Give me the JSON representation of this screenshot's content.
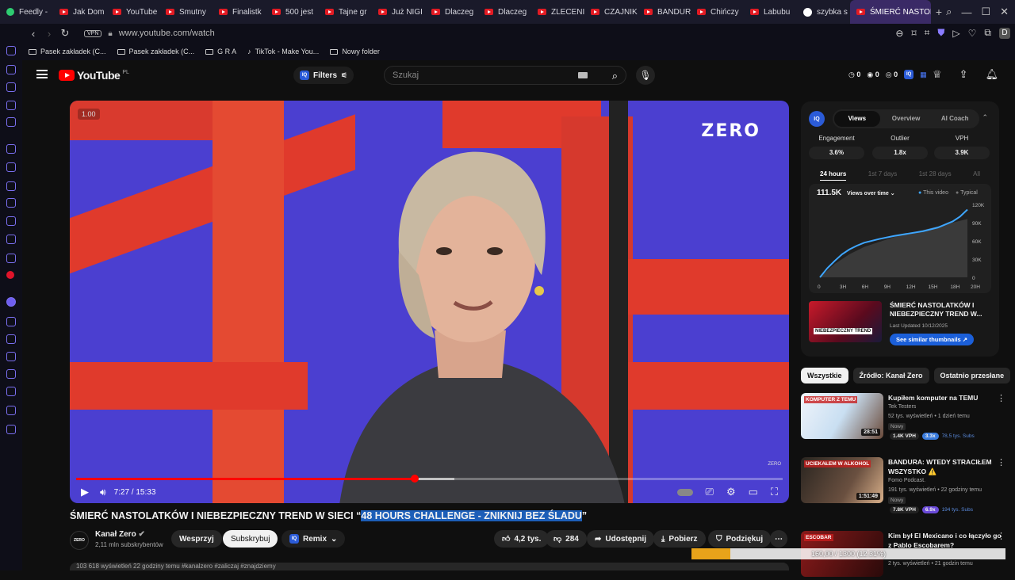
{
  "browser": {
    "tabs": [
      {
        "label": "Feedly -",
        "icon": "feedly-icon"
      },
      {
        "label": "Jak Dom",
        "icon": "youtube-icon"
      },
      {
        "label": "YouTube",
        "icon": "youtube-icon"
      },
      {
        "label": "Smutny",
        "icon": "youtube-icon"
      },
      {
        "label": "Finalistk",
        "icon": "youtube-icon"
      },
      {
        "label": "500 jest",
        "icon": "youtube-icon"
      },
      {
        "label": "Tajne gr",
        "icon": "youtube-icon"
      },
      {
        "label": "Już NIGI",
        "icon": "youtube-icon"
      },
      {
        "label": "Dlaczeg",
        "icon": "youtube-icon"
      },
      {
        "label": "Dlaczeg",
        "icon": "youtube-icon"
      },
      {
        "label": "ZLECENI",
        "icon": "youtube-icon"
      },
      {
        "label": "CZAJNIK",
        "icon": "youtube-icon"
      },
      {
        "label": "BANDUR",
        "icon": "youtube-icon"
      },
      {
        "label": "Chińczy",
        "icon": "youtube-icon"
      },
      {
        "label": "Labubu",
        "icon": "youtube-icon"
      },
      {
        "label": "szybka s",
        "icon": "google-icon"
      },
      {
        "label": "ŚMIERĆ NASTOL",
        "icon": "youtube-icon",
        "active": true
      }
    ],
    "new_tab": "+",
    "vpn": "VPN",
    "url": "www.youtube.com/watch",
    "profile_initial": "D",
    "bookmarks": [
      {
        "label": "Pasek zakładek (C...",
        "icon": "folder-icon"
      },
      {
        "label": "Pasek zakładek (C...",
        "icon": "folder-icon"
      },
      {
        "label": "G R A",
        "icon": "folder-icon"
      },
      {
        "label": "TikTok - Make You...",
        "icon": "tiktok-icon"
      },
      {
        "label": "Nowy folder",
        "icon": "folder-icon"
      }
    ]
  },
  "youtube": {
    "logo_text": "YouTube",
    "logo_country": "PL",
    "filters_label": "Filters",
    "search_placeholder": "Szukaj",
    "header_counts": [
      "0",
      "0",
      "0"
    ],
    "video": {
      "speed_badge": "1.00",
      "watermark": "ZERO",
      "watermark_small": "ZERO",
      "time": "7:27 / 15:33",
      "progress_fraction": 0.479,
      "buffered_fraction": 0.535
    },
    "title_plain": "ŚMIERĆ NASTOLATKÓW I NIEBEZPIECZNY TREND W SIECI “",
    "title_highlight": "48 HOURS CHALLENGE - ZNIKNIJ BEZ ŚLADU",
    "title_end": "”",
    "channel": {
      "avatar_text": "ZERO",
      "name": "Kanał Zero",
      "subs": "2,11 mln subskrybentów",
      "support": "Wesprzyj",
      "subscribe": "Subskrybuj",
      "remix": "Remix",
      "likes": "4,2 tys.",
      "dislikes": "284",
      "share": "Udostępnij",
      "download": "Pobierz",
      "thanks": "Podziękuj",
      "more": "⋯"
    },
    "description_peek": "103 618 wyświetleń  22 godziny temu  #kanalzero #zaliczaj #znajdziemy"
  },
  "vidiq": {
    "tabs": [
      "Views",
      "Overview",
      "AI Coach"
    ],
    "active_tab": "Views",
    "metrics": [
      {
        "label": "Engagement",
        "value": "3.6%"
      },
      {
        "label": "Outlier",
        "value": "1.8x"
      },
      {
        "label": "VPH",
        "value": "3.9K"
      }
    ],
    "ranges": [
      "24 hours",
      "1st 7 days",
      "1st 28 days",
      "All"
    ],
    "active_range": "24 hours",
    "total": "111.5K",
    "views_label": "Views over time",
    "legend_this": "This video",
    "legend_typical": "Typical",
    "thumb_title": "ŚMIERĆ NASTOLATKÓW I NIEBEZPIECZNY TREND W...",
    "thumb_updated": "Last Updated 10/12/2025",
    "similar_btn": "See similar thumbnails",
    "thumb_overlay": "NIEBEZPIECZNY TREND"
  },
  "chart_data": {
    "type": "area",
    "title": "",
    "xlabel": "",
    "ylabel": "",
    "x": [
      "0",
      "3H",
      "6H",
      "9H",
      "12H",
      "15H",
      "18H",
      "20H"
    ],
    "xlim": [
      0,
      20
    ],
    "ylim": [
      0,
      120000
    ],
    "yticks": [
      "0",
      "30K",
      "60K",
      "90K",
      "120K"
    ],
    "series": [
      {
        "name": "This video",
        "color": "#3ea6ff",
        "points": [
          [
            0,
            0
          ],
          [
            1,
            15000
          ],
          [
            2,
            27000
          ],
          [
            3,
            38000
          ],
          [
            4,
            46000
          ],
          [
            5,
            52000
          ],
          [
            6,
            57000
          ],
          [
            8,
            63000
          ],
          [
            10,
            68000
          ],
          [
            12,
            72000
          ],
          [
            14,
            76000
          ],
          [
            16,
            82000
          ],
          [
            18,
            92000
          ],
          [
            19,
            100000
          ],
          [
            20,
            111500
          ]
        ]
      },
      {
        "name": "Typical",
        "color": "#555555",
        "points": [
          [
            0,
            0
          ],
          [
            2,
            22000
          ],
          [
            4,
            38000
          ],
          [
            6,
            50000
          ],
          [
            8,
            58000
          ],
          [
            10,
            66000
          ],
          [
            12,
            72000
          ],
          [
            14,
            78000
          ],
          [
            16,
            84000
          ],
          [
            18,
            90000
          ],
          [
            20,
            96000
          ]
        ]
      }
    ],
    "legend": "top-right",
    "grid": false
  },
  "feed": {
    "chips": [
      "Wszystkie",
      "Źródło: Kanał Zero",
      "Ostatnio przesłane"
    ],
    "items": [
      {
        "title": "Kupiłem komputer na TEMU",
        "channel": "Tek Testers",
        "stats": "52 tys. wyświetleń • 1 dzień temu",
        "badge": "Nowy",
        "duration": "28:51",
        "vph": "1.4K VPH",
        "mult": "3.3x",
        "subs": "78,5 tys. Subs",
        "thumb_text": "KOMPUTER Z TEMU"
      },
      {
        "title": "BANDURA: WTEDY STRACIŁEM WSZYSTKO ⚠️",
        "channel": "Fomo Podcast.",
        "stats": "191 tys. wyświetleń • 22 godziny temu",
        "badge": "Nowy",
        "duration": "1:51:49",
        "vph": "7.8K VPH",
        "mult": "6.9x",
        "subs": "194 tys. Subs",
        "thumb_text": "UCIEKAŁEM W ALKOHOL"
      },
      {
        "title": "Kim był El Mexicano i co łączyło go z Pablo Escobarem?",
        "channel": "",
        "stats": "2 tys. wyświetleń • 21 godzin temu",
        "badge": "",
        "duration": "",
        "vph": "",
        "mult": "",
        "subs": "",
        "thumb_text": "ESCOBAR"
      }
    ]
  },
  "download": {
    "text": "160,00 / 1300 (12.31%)",
    "progress": 0.1231
  }
}
